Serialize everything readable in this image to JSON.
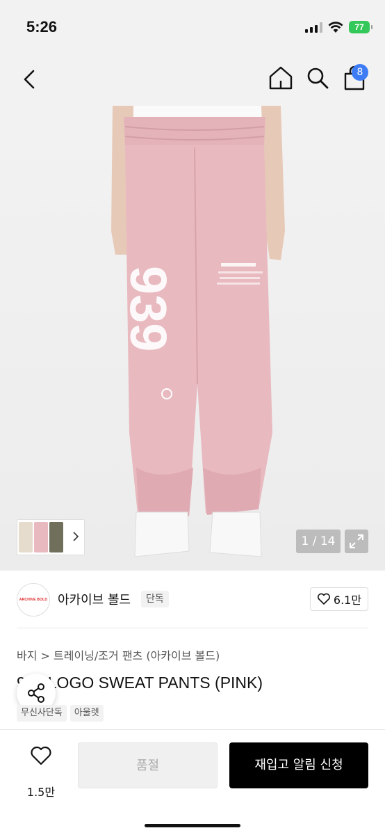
{
  "status": {
    "time": "5:26",
    "battery": "77"
  },
  "nav": {
    "cart_count": "8"
  },
  "gallery": {
    "counter": "1 / 14",
    "print_text": "939",
    "print_small": "ARCHIVE"
  },
  "brand": {
    "logo_text": "ARCHIVE BOLD",
    "name": "아카이브 볼드",
    "tag": "단독",
    "likes": "6.1만"
  },
  "breadcrumb": "바지 > 트레이닝/조거 팬츠 (아카이브 볼드)",
  "product": {
    "title": "939 LOGO SWEAT PANTS (PINK)",
    "tags": [
      "무신사단독",
      "아울렛"
    ]
  },
  "bottom": {
    "wish_count": "1.5만",
    "soldout_label": "품절",
    "restock_label": "재입고 알림 신청"
  },
  "colors": {
    "accent_badge": "#3d7cf5",
    "pants_pink": "#e8b9bf",
    "battery_green": "#34c759",
    "button_black": "#000000"
  }
}
